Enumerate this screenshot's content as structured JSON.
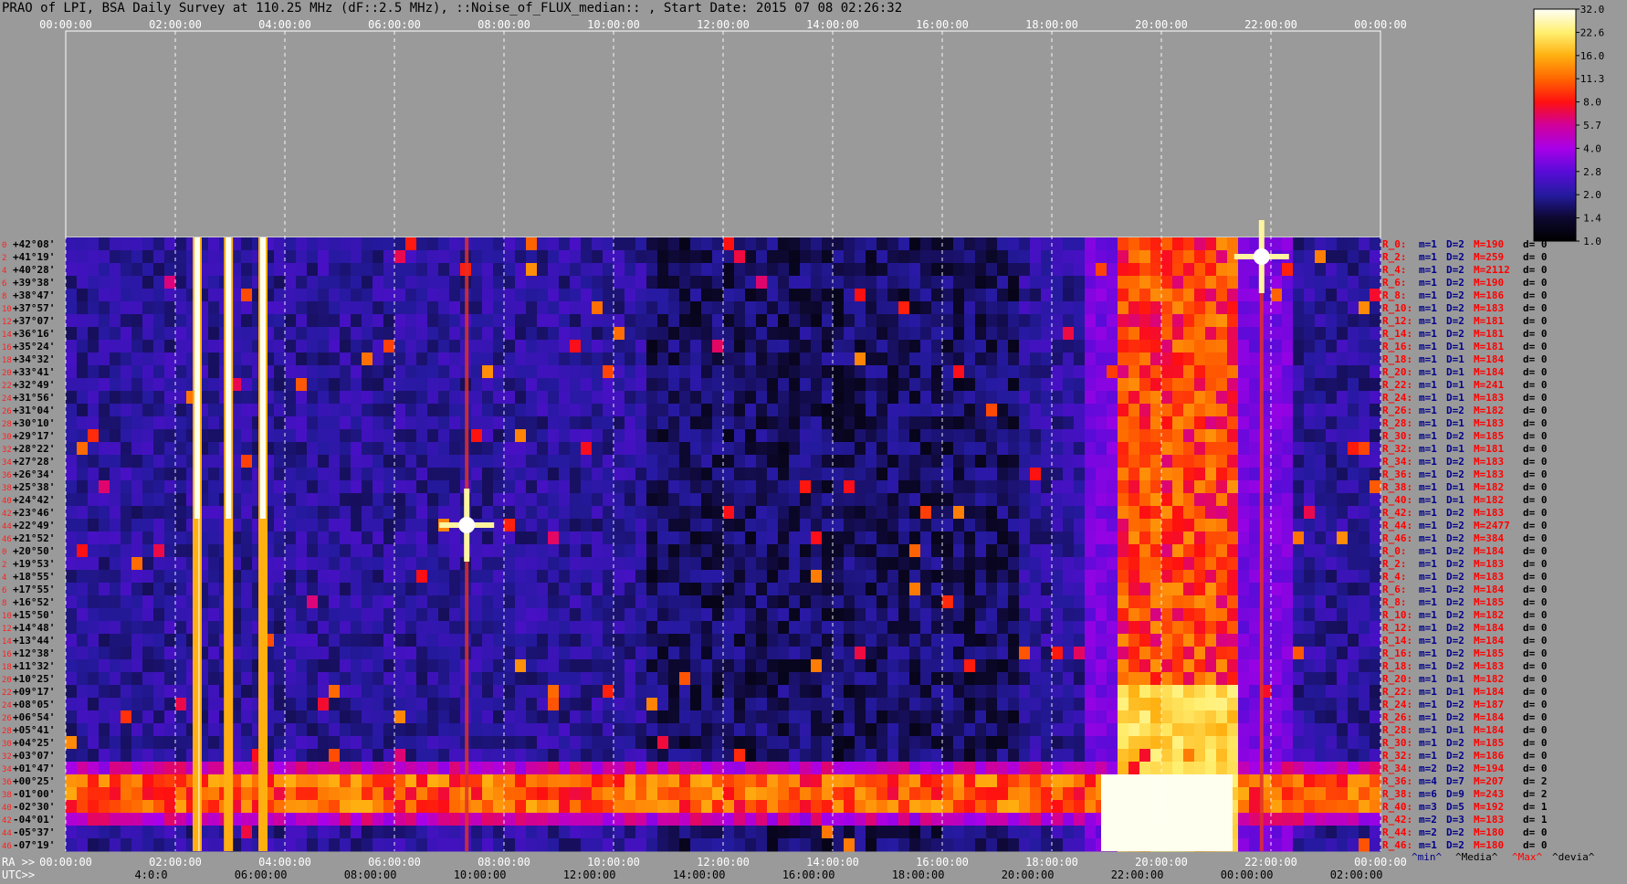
{
  "title": "PRAO of LPI, BSA Daily Survey at 110.25 MHz (dF::2.5 MHz), ::Noise_of_FLUX_median:: , Start Date: 2015 07 08 02:26:32",
  "chart_data": {
    "type": "heatmap",
    "title": "PRAO of LPI, BSA Daily Survey at 110.25 MHz (dF::2.5 MHz), ::Noise_of_FLUX_median:: , Start Date: 2015 07 08 02:26:32",
    "top_time_ticks": [
      "00:00:00",
      "02:00:00",
      "04:00:00",
      "06:00:00",
      "08:00:00",
      "10:00:00",
      "12:00:00",
      "14:00:00",
      "16:00:00",
      "18:00:00",
      "20:00:00",
      "22:00:00",
      "00:00:00"
    ],
    "ra_ticks": [
      "00:00:00",
      "02:00:00",
      "04:00:00",
      "06:00:00",
      "08:00:00",
      "10:00:00",
      "12:00:00",
      "14:00:00",
      "16:00:00",
      "18:00:00",
      "20:00:00",
      "22:00:00",
      "00:00:00"
    ],
    "utc_ticks": [
      "4:0:0",
      "06:00:00",
      "08:00:00",
      "10:00:00",
      "12:00:00",
      "14:00:00",
      "16:00:00",
      "18:00:00",
      "20:00:00",
      "22:00:00",
      "00:00:00",
      "02:00:00"
    ],
    "ra_prefix": "RA >>",
    "utc_prefix": "UTC>>",
    "colorbar": {
      "ticks": [
        "32.0",
        "22.6",
        "16.0",
        "11.3",
        "8.0",
        "5.7",
        "4.0",
        "2.8",
        "2.0",
        "1.4",
        "1.0"
      ],
      "colors": [
        "#fffff8",
        "#fff070",
        "#ffb010",
        "#ff6600",
        "#ff1010",
        "#d0009a",
        "#a800e8",
        "#5a0bd8",
        "#251aa0",
        "#0d0830",
        "#000000"
      ]
    },
    "declinations": [
      "+42°08'",
      "+41°19'",
      "+40°28'",
      "+39°38'",
      "+38°47'",
      "+37°57'",
      "+37°07'",
      "+36°16'",
      "+35°24'",
      "+34°32'",
      "+33°41'",
      "+32°49'",
      "+31°56'",
      "+31°04'",
      "+30°10'",
      "+29°17'",
      "+28°22'",
      "+27°28'",
      "+26°34'",
      "+25°38'",
      "+24°42'",
      "+23°46'",
      "+22°49'",
      "+21°52'",
      "+20°50'",
      "+19°53'",
      "+18°55'",
      "+17°55'",
      "+16°52'",
      "+15°50'",
      "+14°48'",
      "+13°44'",
      "+12°38'",
      "+11°32'",
      "+10°25'",
      "+09°17'",
      "+08°05'",
      "+06°54'",
      "+05°41'",
      "+04°25'",
      "+03°07'",
      "+01°47'",
      "+00°25'",
      "-01°00'",
      "-02°30'",
      "-04°01'",
      "-05°37'",
      "-07°19'"
    ],
    "beam_index_labels": [
      "0",
      "2",
      "4",
      "6",
      "8",
      "10",
      "12",
      "14",
      "16",
      "18",
      "20",
      "22",
      "24",
      "26",
      "28",
      "30",
      "32",
      "34",
      "36",
      "38",
      "40",
      "42",
      "44",
      "46",
      "0",
      "2",
      "4",
      "6",
      "8",
      "10",
      "12",
      "14",
      "16",
      "18",
      "20",
      "22",
      "24",
      "26",
      "28",
      "30",
      "32",
      "34",
      "36",
      "38",
      "40",
      "42",
      "44",
      "46"
    ],
    "row_stats": [
      {
        "r": "R_0:",
        "m": "m=1",
        "D": "D=2",
        "M": "M=190",
        "d": "d= 0"
      },
      {
        "r": "R_2:",
        "m": "m=1",
        "D": "D=2",
        "M": "M=259",
        "d": "d= 0"
      },
      {
        "r": "R_4:",
        "m": "m=1",
        "D": "D=2",
        "M": "M=2112",
        "d": "d= 0"
      },
      {
        "r": "R_6:",
        "m": "m=1",
        "D": "D=2",
        "M": "M=190",
        "d": "d= 0"
      },
      {
        "r": "R_8:",
        "m": "m=1",
        "D": "D=2",
        "M": "M=186",
        "d": "d= 0"
      },
      {
        "r": "R_10:",
        "m": "m=1",
        "D": "D=2",
        "M": "M=183",
        "d": "d= 0"
      },
      {
        "r": "R_12:",
        "m": "m=1",
        "D": "D=2",
        "M": "M=181",
        "d": "d= 0"
      },
      {
        "r": "R_14:",
        "m": "m=1",
        "D": "D=2",
        "M": "M=181",
        "d": "d= 0"
      },
      {
        "r": "R_16:",
        "m": "m=1",
        "D": "D=1",
        "M": "M=181",
        "d": "d= 0"
      },
      {
        "r": "R_18:",
        "m": "m=1",
        "D": "D=1",
        "M": "M=184",
        "d": "d= 0"
      },
      {
        "r": "R_20:",
        "m": "m=1",
        "D": "D=1",
        "M": "M=184",
        "d": "d= 0"
      },
      {
        "r": "R_22:",
        "m": "m=1",
        "D": "D=1",
        "M": "M=241",
        "d": "d= 0"
      },
      {
        "r": "R_24:",
        "m": "m=1",
        "D": "D=1",
        "M": "M=183",
        "d": "d= 0"
      },
      {
        "r": "R_26:",
        "m": "m=1",
        "D": "D=2",
        "M": "M=182",
        "d": "d= 0"
      },
      {
        "r": "R_28:",
        "m": "m=1",
        "D": "D=1",
        "M": "M=183",
        "d": "d= 0"
      },
      {
        "r": "R_30:",
        "m": "m=1",
        "D": "D=2",
        "M": "M=185",
        "d": "d= 0"
      },
      {
        "r": "R_32:",
        "m": "m=1",
        "D": "D=1",
        "M": "M=181",
        "d": "d= 0"
      },
      {
        "r": "R_34:",
        "m": "m=1",
        "D": "D=2",
        "M": "M=183",
        "d": "d= 0"
      },
      {
        "r": "R_36:",
        "m": "m=1",
        "D": "D=2",
        "M": "M=183",
        "d": "d= 0"
      },
      {
        "r": "R_38:",
        "m": "m=1",
        "D": "D=1",
        "M": "M=182",
        "d": "d= 0"
      },
      {
        "r": "R_40:",
        "m": "m=1",
        "D": "D=1",
        "M": "M=182",
        "d": "d= 0"
      },
      {
        "r": "R_42:",
        "m": "m=1",
        "D": "D=2",
        "M": "M=183",
        "d": "d= 0"
      },
      {
        "r": "R_44:",
        "m": "m=1",
        "D": "D=2",
        "M": "M=2477",
        "d": "d= 0"
      },
      {
        "r": "R_46:",
        "m": "m=1",
        "D": "D=2",
        "M": "M=384",
        "d": "d= 0"
      },
      {
        "r": "R_0:",
        "m": "m=1",
        "D": "D=2",
        "M": "M=184",
        "d": "d= 0"
      },
      {
        "r": "R_2:",
        "m": "m=1",
        "D": "D=2",
        "M": "M=183",
        "d": "d= 0"
      },
      {
        "r": "R_4:",
        "m": "m=1",
        "D": "D=2",
        "M": "M=183",
        "d": "d= 0"
      },
      {
        "r": "R_6:",
        "m": "m=1",
        "D": "D=2",
        "M": "M=184",
        "d": "d= 0"
      },
      {
        "r": "R_8:",
        "m": "m=1",
        "D": "D=2",
        "M": "M=185",
        "d": "d= 0"
      },
      {
        "r": "R_10:",
        "m": "m=1",
        "D": "D=2",
        "M": "M=182",
        "d": "d= 0"
      },
      {
        "r": "R_12:",
        "m": "m=1",
        "D": "D=2",
        "M": "M=184",
        "d": "d= 0"
      },
      {
        "r": "R_14:",
        "m": "m=1",
        "D": "D=2",
        "M": "M=184",
        "d": "d= 0"
      },
      {
        "r": "R_16:",
        "m": "m=1",
        "D": "D=2",
        "M": "M=185",
        "d": "d= 0"
      },
      {
        "r": "R_18:",
        "m": "m=1",
        "D": "D=2",
        "M": "M=183",
        "d": "d= 0"
      },
      {
        "r": "R_20:",
        "m": "m=1",
        "D": "D=1",
        "M": "M=182",
        "d": "d= 0"
      },
      {
        "r": "R_22:",
        "m": "m=1",
        "D": "D=1",
        "M": "M=184",
        "d": "d= 0"
      },
      {
        "r": "R_24:",
        "m": "m=1",
        "D": "D=2",
        "M": "M=187",
        "d": "d= 0"
      },
      {
        "r": "R_26:",
        "m": "m=1",
        "D": "D=2",
        "M": "M=184",
        "d": "d= 0"
      },
      {
        "r": "R_28:",
        "m": "m=1",
        "D": "D=1",
        "M": "M=184",
        "d": "d= 0"
      },
      {
        "r": "R_30:",
        "m": "m=1",
        "D": "D=2",
        "M": "M=185",
        "d": "d= 0"
      },
      {
        "r": "R_32:",
        "m": "m=1",
        "D": "D=2",
        "M": "M=186",
        "d": "d= 0"
      },
      {
        "r": "R_34:",
        "m": "m=2",
        "D": "D=2",
        "M": "M=194",
        "d": "d= 0"
      },
      {
        "r": "R_36:",
        "m": "m=4",
        "D": "D=7",
        "M": "M=207",
        "d": "d= 2"
      },
      {
        "r": "R_38:",
        "m": "m=6",
        "D": "D=9",
        "M": "M=243",
        "d": "d= 2"
      },
      {
        "r": "R_40:",
        "m": "m=3",
        "D": "D=5",
        "M": "M=192",
        "d": "d= 1"
      },
      {
        "r": "R_42:",
        "m": "m=2",
        "D": "D=3",
        "M": "M=183",
        "d": "d= 1"
      },
      {
        "r": "R_44:",
        "m": "m=2",
        "D": "D=2",
        "M": "M=180",
        "d": "d= 0"
      },
      {
        "r": "R_46:",
        "m": "m=1",
        "D": "D=2",
        "M": "M=180",
        "d": "d= 0"
      }
    ],
    "stats_legend": {
      "min": "^min^",
      "median": "^Media^",
      "max": "^Max^",
      "deviation": "^devia^"
    },
    "features": {
      "scan_start_hour": 2.44,
      "vertical_bright_streaks_hours": [
        2.4,
        2.97,
        3.6
      ],
      "point_sources": [
        {
          "hour": 7.32,
          "dec_row": 22,
          "peak": 32
        },
        {
          "hour": 21.83,
          "dec_row": 1,
          "peak": 32
        }
      ],
      "horizontal_bright_band_rows": [
        42,
        43,
        44
      ],
      "galactic_plane_hours": [
        19.3,
        21.3
      ],
      "colors": {
        "background": "#9a9a9a",
        "grid": "#ffffff",
        "index_text": "#ff2020",
        "stat_red": "#ff0000",
        "stat_blue": "#00008b"
      }
    }
  }
}
